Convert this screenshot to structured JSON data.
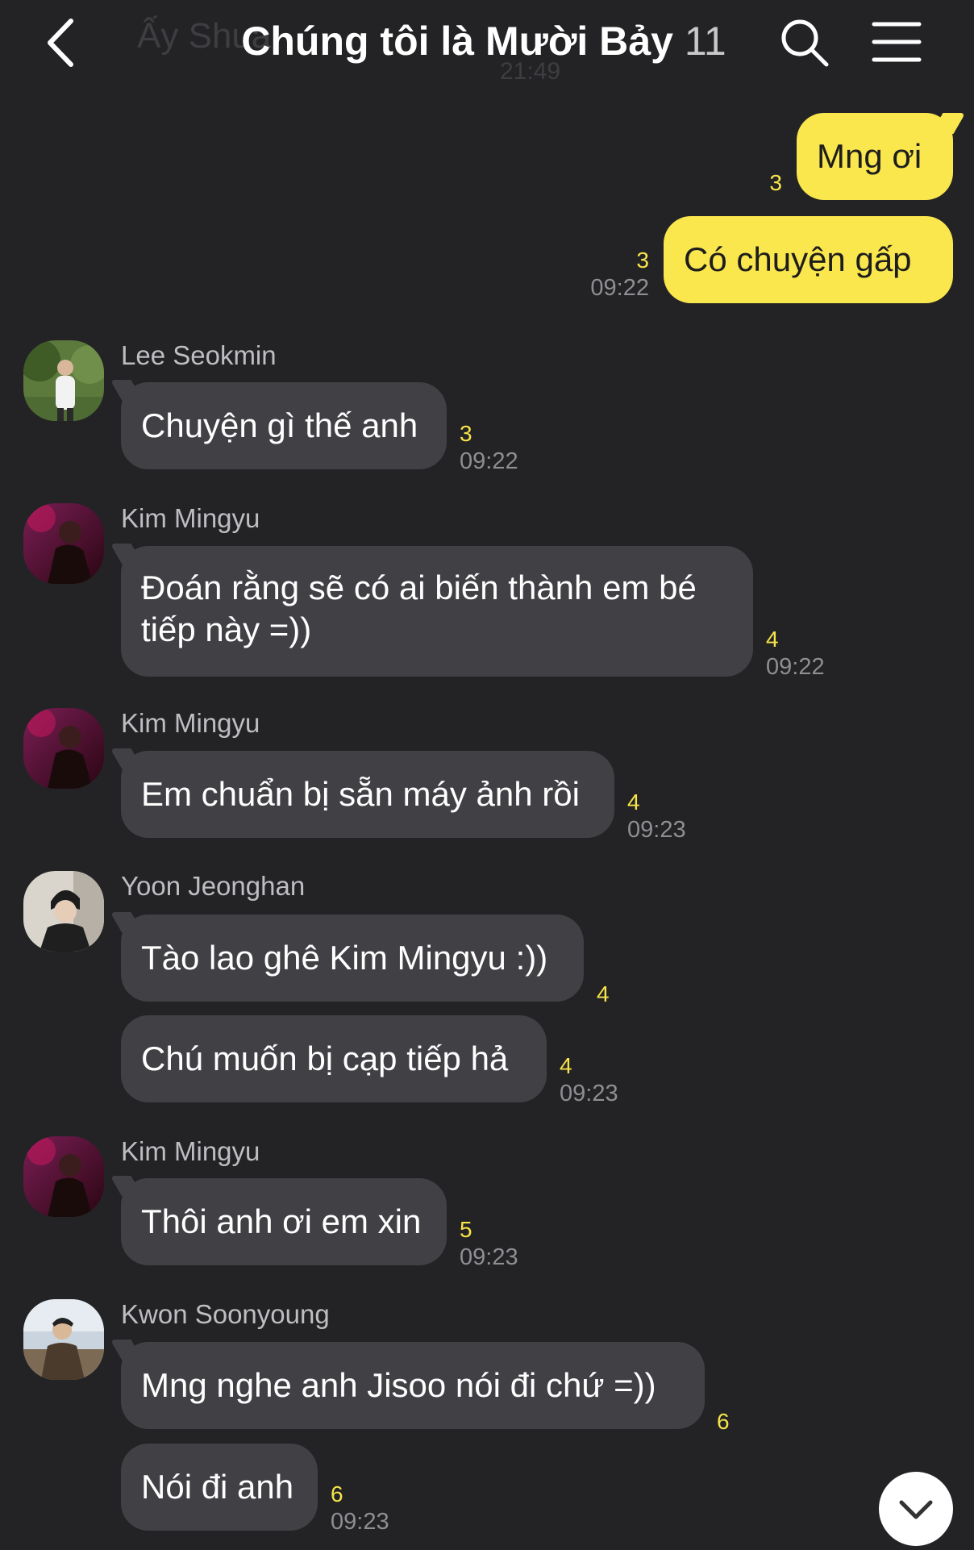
{
  "header": {
    "title": "Chúng tôi là Mười Bảy",
    "member_count": "11",
    "ghost_sender": "Ấy Shua",
    "ghost_time": "21:49"
  },
  "icons": {
    "back": "chevron-left-icon",
    "search": "search-icon",
    "menu": "hamburger-menu-icon",
    "scroll_down": "chevron-down-icon"
  },
  "colors": {
    "background": "#232325",
    "incoming_bubble": "#414145",
    "outgoing_bubble": "#fae64d",
    "unread_count": "#f7e34a"
  },
  "messages": {
    "m1": {
      "text": "Mng ơi",
      "unread": "3"
    },
    "m2": {
      "text": "Có chuyện gấp",
      "unread": "3",
      "time": "09:22"
    },
    "m3": {
      "sender": "Lee Seokmin",
      "text": "Chuyện gì thế anh",
      "unread": "3",
      "time": "09:22"
    },
    "m4": {
      "sender": "Kim Mingyu",
      "text": "Đoán rằng sẽ có ai biến thành em bé tiếp này =))",
      "unread": "4",
      "time": "09:22"
    },
    "m5": {
      "sender": "Kim Mingyu",
      "text": "Em chuẩn bị sẵn máy ảnh rồi",
      "unread": "4",
      "time": "09:23"
    },
    "m6": {
      "sender": "Yoon Jeonghan",
      "text": "Tào lao ghê Kim Mingyu :))",
      "unread": "4"
    },
    "m7": {
      "text": "Chú muốn bị cạp tiếp hả",
      "unread": "4",
      "time": "09:23"
    },
    "m8": {
      "sender": "Kim Mingyu",
      "text": "Thôi anh ơi em xin",
      "unread": "5",
      "time": "09:23"
    },
    "m9": {
      "sender": "Kwon Soonyoung",
      "text": "Mng nghe anh Jisoo nói đi chứ =))",
      "unread": "6"
    },
    "m10": {
      "text": "Nói đi anh",
      "unread": "6",
      "time": "09:23"
    }
  }
}
